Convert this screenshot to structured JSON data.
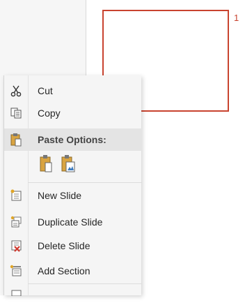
{
  "slide_panel": {
    "slide_number": "1"
  },
  "context_menu": {
    "items": [
      {
        "label": "Cut",
        "icon": "scissors-icon"
      },
      {
        "label": "Copy",
        "icon": "copy-icon"
      },
      {
        "label": "Paste Options:",
        "icon": "paste-icon"
      },
      {
        "label": "New Slide",
        "icon": "new-slide-icon"
      },
      {
        "label": "Duplicate Slide",
        "icon": "duplicate-slide-icon"
      },
      {
        "label": "Delete Slide",
        "icon": "delete-slide-icon"
      },
      {
        "label": "Add Section",
        "icon": "add-section-icon"
      }
    ],
    "paste_option_icons": [
      "paste-keep-formatting-icon",
      "paste-as-picture-icon"
    ]
  },
  "colors": {
    "selection_border": "#c8432f",
    "menu_background": "#f5f5f5",
    "highlight": "#e4e4e4"
  }
}
